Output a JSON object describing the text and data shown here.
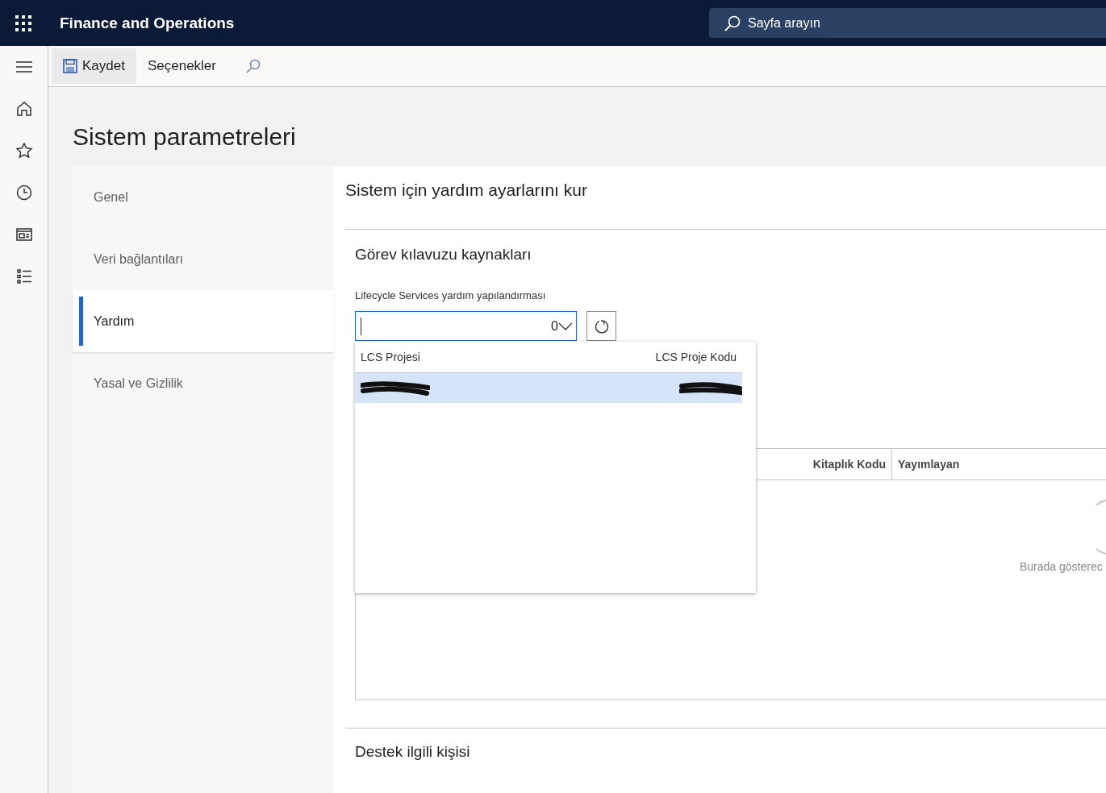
{
  "app_bar": {
    "title": "Finance and Operations",
    "search": {
      "placeholder": "Sayfa arayın"
    }
  },
  "toolbar": {
    "buttons": [
      {
        "label": "Kaydet",
        "kind": "save",
        "selected": true
      },
      {
        "label": "Seçenekler",
        "kind": "plain",
        "selected": false
      }
    ]
  },
  "page_title": "Sistem parametreleri",
  "tabs": [
    {
      "label": "Genel",
      "selected": false
    },
    {
      "label": "Veri bağlantıları",
      "selected": false
    },
    {
      "label": "Yardım",
      "selected": true
    },
    {
      "label": "Yasal ve Gizlilik",
      "selected": false
    }
  ],
  "section": {
    "title": "Sistem için yardım ayarlarını kur",
    "task_guide": {
      "title": "Görev kılavuzu kaynakları",
      "lcs_field": {
        "label": "Lifecycle Services yardım yapılandırması",
        "count": "0"
      },
      "lookup": {
        "columns": [
          "LCS Projesi",
          "LCS Proje Kodu"
        ],
        "rows": [
          {
            "selected": true
          }
        ]
      },
      "library_grid": {
        "columns": [
          "Kitaplık Kodu",
          "Yayımlayan"
        ],
        "empty_message": "Burada gösterec"
      }
    },
    "support": {
      "title": "Destek ilgili kişisi"
    }
  }
}
